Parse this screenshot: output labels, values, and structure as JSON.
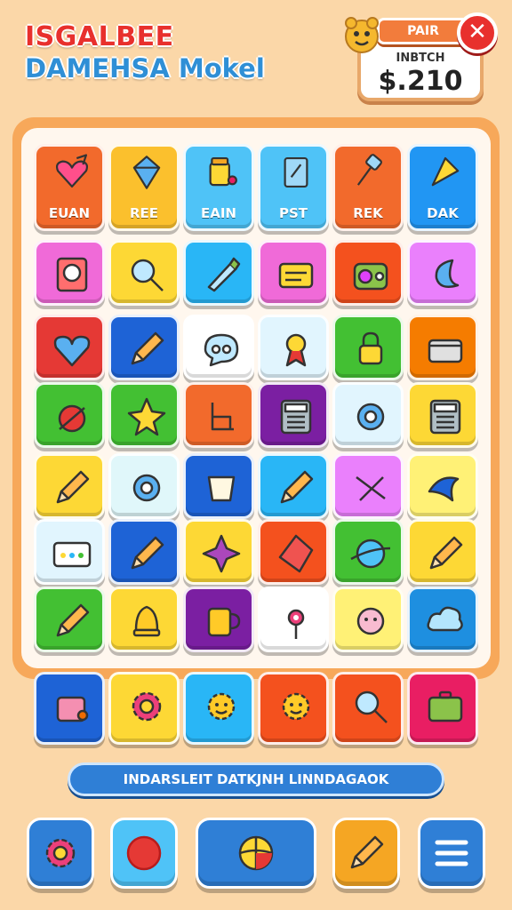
{
  "header": {
    "title_line1": "ISGALBEE",
    "title_line2": "DAMEHSA Mokel",
    "pair_tab": "PAIR",
    "score_label": "INBTCH",
    "score_value": "$.210",
    "close_label": "✕"
  },
  "tiles": [
    {
      "icon": "heart-arrow-icon",
      "label": "EUAN",
      "color": "#f26a2c"
    },
    {
      "icon": "kite-icon",
      "label": "REE",
      "color": "#fbc02d"
    },
    {
      "icon": "jar-icon",
      "label": "EAIN",
      "color": "#4fc3f7"
    },
    {
      "icon": "clipboard-icon",
      "label": "PST",
      "color": "#4fc3f7"
    },
    {
      "icon": "hammer-icon",
      "label": "REK",
      "color": "#f26a2c"
    },
    {
      "icon": "cone-icon",
      "label": "DAK",
      "color": "#2196f3"
    },
    {
      "icon": "portrait-icon",
      "label": "",
      "color": "#f06ad8"
    },
    {
      "icon": "magnifier-icon",
      "label": "",
      "color": "#fdd835"
    },
    {
      "icon": "pen-icon",
      "label": "",
      "color": "#29b6f6"
    },
    {
      "icon": "sign-icon",
      "label": "",
      "color": "#f06ad8"
    },
    {
      "icon": "radio-icon",
      "label": "",
      "color": "#f4511e"
    },
    {
      "icon": "moon-icon",
      "label": "",
      "color": "#ea80fc"
    },
    {
      "icon": "heart-icon",
      "label": "",
      "color": "#e53935"
    },
    {
      "icon": "pencil-icon",
      "label": "",
      "color": "#1e63d6"
    },
    {
      "icon": "bubble-icon",
      "label": "",
      "color": "#ffffff"
    },
    {
      "icon": "medal-icon",
      "label": "",
      "color": "#e1f5fe"
    },
    {
      "icon": "lock-icon",
      "label": "",
      "color": "#43c033"
    },
    {
      "icon": "box-icon",
      "label": "",
      "color": "#f57c00"
    },
    {
      "icon": "ornament-icon",
      "label": "",
      "color": "#43c033"
    },
    {
      "icon": "star-icon",
      "label": "",
      "color": "#43c033"
    },
    {
      "icon": "chair-icon",
      "label": "",
      "color": "#f26a2c"
    },
    {
      "icon": "calculator-icon",
      "label": "",
      "color": "#7b1fa2"
    },
    {
      "icon": "ring-icon",
      "label": "",
      "color": "#e1f5fe"
    },
    {
      "icon": "calculator-icon",
      "label": "",
      "color": "#fdd835"
    },
    {
      "icon": "pencil-icon",
      "label": "",
      "color": "#fdd835"
    },
    {
      "icon": "ring-icon",
      "label": "",
      "color": "#e0f7fa"
    },
    {
      "icon": "cup-icon",
      "label": "",
      "color": "#1e63d6"
    },
    {
      "icon": "pencil-icon",
      "label": "",
      "color": "#29b6f6"
    },
    {
      "icon": "cross-icon",
      "label": "",
      "color": "#ea80fc"
    },
    {
      "icon": "fish-icon",
      "label": "",
      "color": "#fff176"
    },
    {
      "icon": "keyboard-icon",
      "label": "",
      "color": "#e1f5fe"
    },
    {
      "icon": "pencil-icon",
      "label": "",
      "color": "#1e63d6"
    },
    {
      "icon": "sparkle-icon",
      "label": "",
      "color": "#fdd835"
    },
    {
      "icon": "gem-icon",
      "label": "",
      "color": "#f4511e"
    },
    {
      "icon": "planet-icon",
      "label": "",
      "color": "#43c033"
    },
    {
      "icon": "pencil-icon",
      "label": "",
      "color": "#fdd835"
    },
    {
      "icon": "pencil-icon",
      "label": "",
      "color": "#43c033"
    },
    {
      "icon": "bell-icon",
      "label": "",
      "color": "#fdd835"
    },
    {
      "icon": "mug-icon",
      "label": "",
      "color": "#7b1fa2"
    },
    {
      "icon": "flower-icon",
      "label": "",
      "color": "#ffffff"
    },
    {
      "icon": "face-icon",
      "label": "",
      "color": "#fff176"
    },
    {
      "icon": "cloud-icon",
      "label": "",
      "color": "#1e8fe0"
    },
    {
      "icon": "bag-icon",
      "label": "",
      "color": "#1e63d6"
    },
    {
      "icon": "gear-icon",
      "label": "",
      "color": "#fdd835"
    },
    {
      "icon": "sun-icon",
      "label": "",
      "color": "#29b6f6"
    },
    {
      "icon": "sun-icon",
      "label": "",
      "color": "#f4511e"
    },
    {
      "icon": "magnifier-icon",
      "label": "",
      "color": "#f4511e"
    },
    {
      "icon": "suitcase-icon",
      "label": "",
      "color": "#e91e63"
    }
  ],
  "status_bar": "INDARSLEIT DATKJNH LINNDAGAOK",
  "toolbar": [
    {
      "icon": "gear-icon",
      "color": "#2f7fd6"
    },
    {
      "icon": "record-icon",
      "color": "#4fc3f7"
    },
    {
      "icon": "ball-icon",
      "color": "#2f7fd6"
    },
    {
      "icon": "pencil-icon",
      "color": "#f5a623"
    },
    {
      "icon": "menu-icon",
      "color": "#2f7fd6"
    }
  ]
}
